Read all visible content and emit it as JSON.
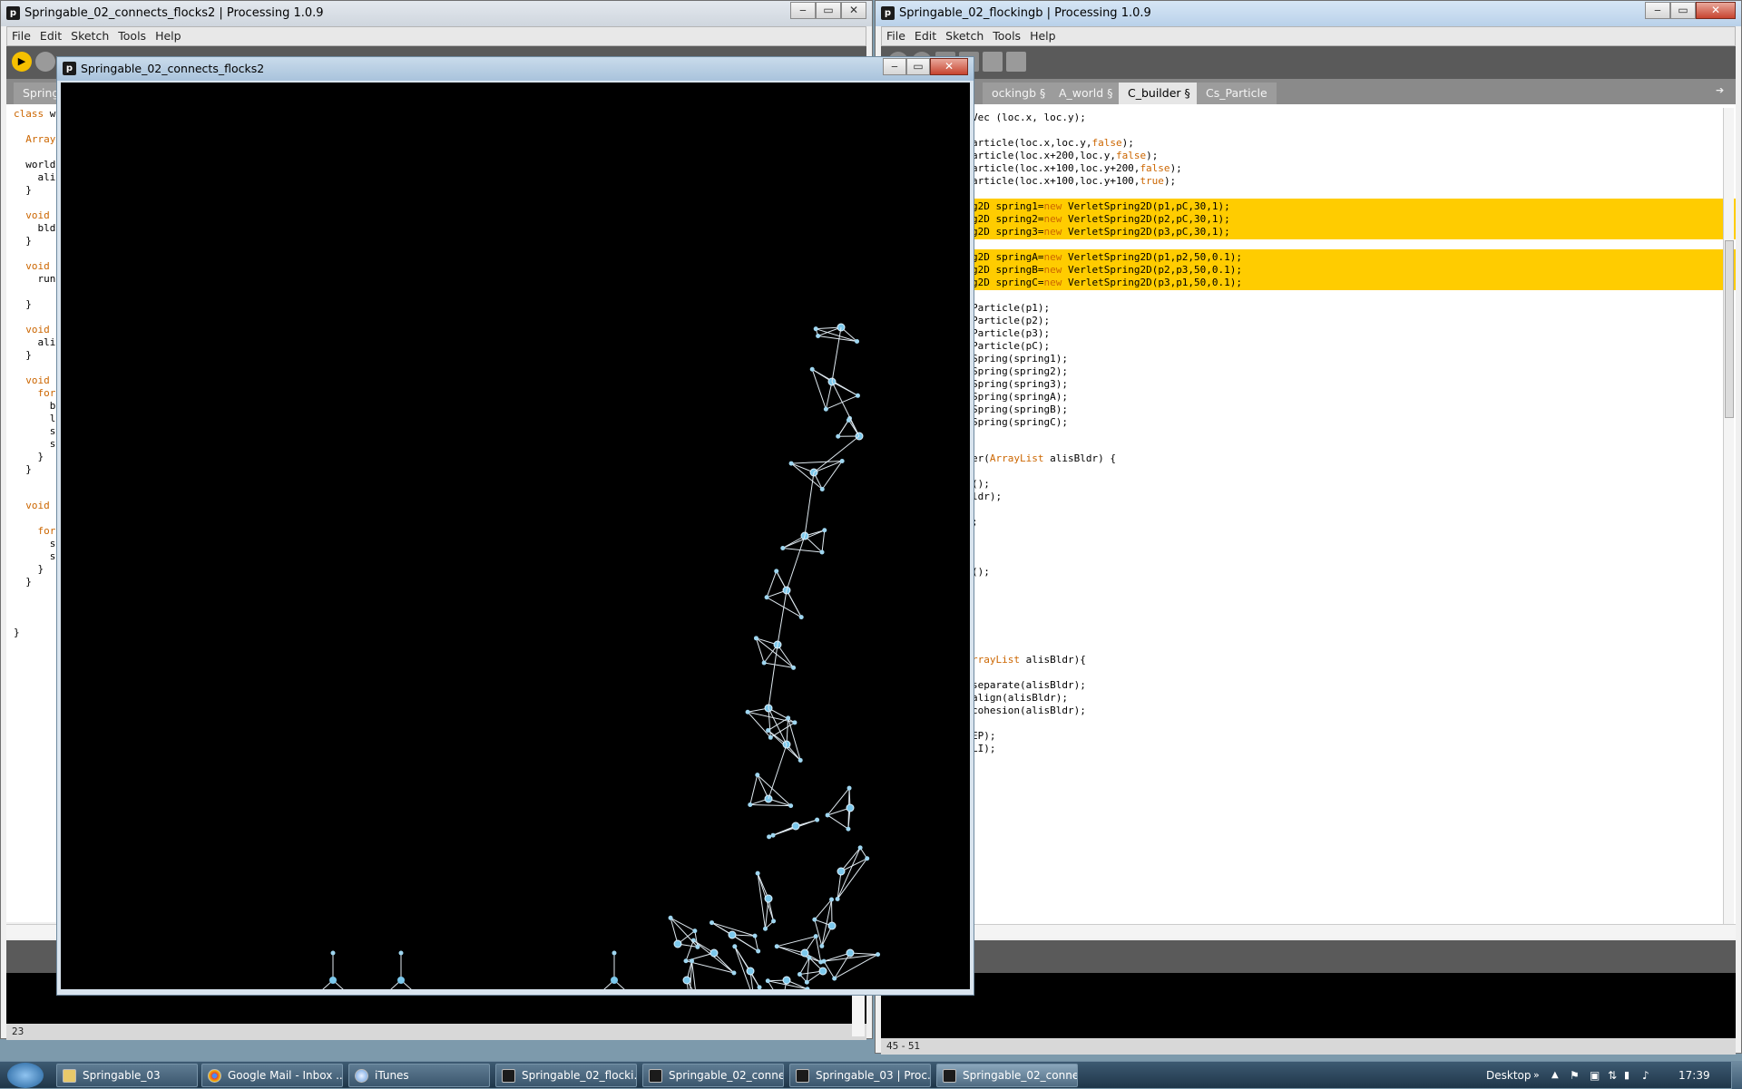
{
  "left_window": {
    "title": "Springable_02_connects_flocks2 | Processing 1.0.9",
    "menu": [
      "File",
      "Edit",
      "Sketch",
      "Tools",
      "Help"
    ],
    "tab_label": "Spring",
    "status_line": "23",
    "code_lines": [
      {
        "text": "class w",
        "kw": "class"
      },
      {
        "text": "  Array",
        "kw": "Array"
      },
      {
        "text": "  world",
        "kw": ""
      },
      {
        "text": "    ali",
        "kw": ""
      },
      {
        "text": "  }",
        "kw": ""
      },
      {
        "text": "  void",
        "kw": "void"
      },
      {
        "text": "    bld",
        "kw": ""
      },
      {
        "text": "  }",
        "kw": ""
      },
      {
        "text": "  void",
        "kw": "void"
      },
      {
        "text": "    run",
        "kw": ""
      },
      {
        "text": "  }",
        "kw": ""
      },
      {
        "text": "  void",
        "kw": "void"
      },
      {
        "text": "    ali",
        "kw": ""
      },
      {
        "text": "  }",
        "kw": ""
      },
      {
        "text": "  void",
        "kw": "void"
      },
      {
        "text": "    for",
        "kw": "for"
      },
      {
        "text": "      b",
        "kw": ""
      },
      {
        "text": "      l",
        "kw": ""
      },
      {
        "text": "      s",
        "kw": ""
      },
      {
        "text": "      s",
        "kw": ""
      },
      {
        "text": "    }",
        "kw": ""
      },
      {
        "text": "  }",
        "kw": ""
      },
      {
        "text": "  void",
        "kw": "void"
      },
      {
        "text": "    for",
        "kw": "for"
      },
      {
        "text": "      s",
        "kw": ""
      },
      {
        "text": "      s",
        "kw": ""
      },
      {
        "text": "    }",
        "kw": ""
      },
      {
        "text": "  }",
        "kw": ""
      },
      {
        "text": "}",
        "kw": ""
      }
    ]
  },
  "sketch_window": {
    "title": "Springable_02_connects_flocks2"
  },
  "right_window": {
    "title": "Springable_02_flockingb | Processing 1.0.9",
    "menu": [
      "File",
      "Edit",
      "Sketch",
      "Tools",
      "Help"
    ],
    "tabs": [
      {
        "label": "ockingb §",
        "active": false
      },
      {
        "label": "A_world §",
        "active": false
      },
      {
        "label": "C_builder §",
        "active": true
      },
      {
        "label": "Cs_Particle",
        "active": false
      }
    ],
    "status_line": "45 - 51",
    "code_lines": [
      {
        "text": "Vec (loc.x, loc.y);",
        "parts": []
      },
      {
        "text": "article(loc.x,loc.y,false);",
        "parts": [
          "false"
        ]
      },
      {
        "text": "article(loc.x+200,loc.y,false);",
        "parts": [
          "false"
        ]
      },
      {
        "text": "article(loc.x+100,loc.y+200,false);",
        "parts": [
          "false"
        ]
      },
      {
        "text": "article(loc.x+100,loc.y+100,true);",
        "parts": [
          "true"
        ]
      },
      {
        "text": "g2D spring1=new VerletSpring2D(p1,pC,30,1);",
        "parts": [
          "new"
        ],
        "hl": true
      },
      {
        "text": "g2D spring2=new VerletSpring2D(p2,pC,30,1);",
        "parts": [
          "new"
        ],
        "hl": true
      },
      {
        "text": "g2D spring3=new VerletSpring2D(p3,pC,30,1);",
        "parts": [
          "new"
        ],
        "hl": true
      },
      {
        "text": "g2D springA=new VerletSpring2D(p1,p2,50,0.1);",
        "parts": [
          "new"
        ],
        "hl": true
      },
      {
        "text": "g2D springB=new VerletSpring2D(p2,p3,50,0.1);",
        "parts": [
          "new"
        ],
        "hl": true
      },
      {
        "text": "g2D springC=new VerletSpring2D(p3,p1,50,0.1);",
        "parts": [
          "new"
        ],
        "hl": true
      },
      {
        "text": "Particle(p1);",
        "parts": []
      },
      {
        "text": "Particle(p2);",
        "parts": []
      },
      {
        "text": "Particle(p3);",
        "parts": []
      },
      {
        "text": "Particle(pC);",
        "parts": []
      },
      {
        "text": "Spring(spring1);",
        "parts": []
      },
      {
        "text": "Spring(spring2);",
        "parts": []
      },
      {
        "text": "Spring(spring3);",
        "parts": []
      },
      {
        "text": "Spring(springA);",
        "parts": []
      },
      {
        "text": "Spring(springB);",
        "parts": []
      },
      {
        "text": "Spring(springC);",
        "parts": []
      },
      {
        "text": "er(ArrayList alisBldr) {",
        "parts": [
          "ArrayList"
        ]
      },
      {
        "text": "();",
        "parts": []
      },
      {
        "text": "ldr);",
        "parts": []
      },
      {
        "text": ";",
        "parts": []
      },
      {
        "text": "();",
        "parts": []
      },
      {
        "text": "rrayList alisBldr){",
        "parts": [
          "rrayList"
        ]
      },
      {
        "text": "separate(alisBldr);",
        "parts": []
      },
      {
        "text": "align(alisBldr);",
        "parts": []
      },
      {
        "text": "cohesion(alisBldr);",
        "parts": []
      },
      {
        "text": "EP);",
        "parts": []
      },
      {
        "text": "LI);",
        "parts": []
      }
    ]
  },
  "taskbar": {
    "items": [
      {
        "label": "Springable_03",
        "active": false
      },
      {
        "label": "Google Mail - Inbox ...",
        "active": false
      },
      {
        "label": "iTunes",
        "active": false
      },
      {
        "label": "Springable_02_flocki...",
        "active": false
      },
      {
        "label": "Springable_02_conne...",
        "active": false
      },
      {
        "label": "Springable_03 | Proc...",
        "active": false
      },
      {
        "label": "Springable_02_conne...",
        "active": true
      }
    ],
    "desktop_label": "Desktop",
    "clock": "17:39"
  }
}
